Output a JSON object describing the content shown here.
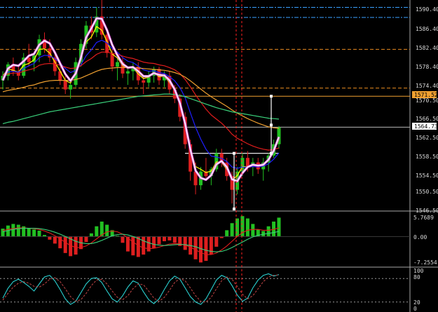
{
  "colors": {
    "background": "#000000",
    "axis_text": "#d8d8d8",
    "divider": "#a8a8a8",
    "candle_up": "#22c022",
    "candle_down": "#dd1f1f",
    "fast_ma": "#ffff00",
    "mid_ma": "#1e1eff",
    "slow_ma": "#e11c1c",
    "orange_ma": "#f0a030",
    "long_ma": "#3ad17b",
    "smooth_line": "#ffffff",
    "smooth_band": "#d850d8",
    "dash_blue": "#3aa0ff",
    "dash_orange": "#e98a1f",
    "level_orange": "#f0a030",
    "current_price_line": "#b8b8b8",
    "highlight_red": "#ff2020",
    "stoch_main": "#2ad0d0",
    "stoch_signal": "#b04040"
  },
  "price_axis": {
    "ticks": [
      "1590.40",
      "1586.40",
      "1582.40",
      "1578.40",
      "1574.40",
      "1570.50",
      "1566.50",
      "1562.50",
      "1558.50",
      "1554.50",
      "1550.50",
      "1546.50"
    ],
    "level_tag": "1571.52",
    "current_tag": "1564.73"
  },
  "macd_axis": {
    "ticks": [
      "5.7689",
      "0.00",
      "-7.2554"
    ]
  },
  "stoch_axis": {
    "ticks": [
      "100",
      "80",
      "20",
      "0"
    ]
  },
  "chart_data": [
    {
      "type": "line",
      "panel": "price",
      "title": "",
      "xlabel": "",
      "ylabel": "",
      "ylim": [
        1546.5,
        1592.0
      ],
      "ohlc": [
        [
          1575.0,
          1577.0,
          1573.0,
          1576.0
        ],
        [
          1576.0,
          1579.0,
          1575.0,
          1578.5
        ],
        [
          1578.5,
          1580.0,
          1576.0,
          1577.0
        ],
        [
          1577.0,
          1578.0,
          1575.0,
          1576.0
        ],
        [
          1576.0,
          1581.0,
          1575.5,
          1580.0
        ],
        [
          1580.0,
          1583.0,
          1578.0,
          1579.0
        ],
        [
          1579.0,
          1581.0,
          1577.0,
          1580.5
        ],
        [
          1580.5,
          1585.0,
          1579.0,
          1584.0
        ],
        [
          1584.0,
          1585.5,
          1581.0,
          1582.0
        ],
        [
          1582.0,
          1584.0,
          1579.0,
          1580.0
        ],
        [
          1580.0,
          1581.0,
          1576.0,
          1577.0
        ],
        [
          1577.0,
          1578.0,
          1574.0,
          1575.0
        ],
        [
          1575.0,
          1576.0,
          1572.0,
          1573.0
        ],
        [
          1573.0,
          1575.0,
          1571.0,
          1574.0
        ],
        [
          1574.0,
          1580.0,
          1573.5,
          1579.0
        ],
        [
          1579.0,
          1584.0,
          1578.0,
          1583.0
        ],
        [
          1583.0,
          1588.0,
          1582.0,
          1587.0
        ],
        [
          1587.0,
          1589.0,
          1584.0,
          1585.5
        ],
        [
          1585.5,
          1591.0,
          1584.5,
          1589.0
        ],
        [
          1589.0,
          1593.0,
          1584.0,
          1585.0
        ],
        [
          1585.0,
          1586.0,
          1580.0,
          1581.0
        ],
        [
          1581.0,
          1582.0,
          1577.0,
          1578.0
        ],
        [
          1578.0,
          1580.0,
          1575.0,
          1579.0
        ],
        [
          1579.0,
          1580.0,
          1575.5,
          1576.5
        ],
        [
          1576.5,
          1578.0,
          1574.0,
          1577.0
        ],
        [
          1577.0,
          1579.0,
          1575.0,
          1578.0
        ],
        [
          1578.0,
          1579.0,
          1574.0,
          1575.0
        ],
        [
          1575.0,
          1576.0,
          1572.0,
          1574.5
        ],
        [
          1574.5,
          1577.0,
          1573.5,
          1576.0
        ],
        [
          1576.0,
          1578.0,
          1574.5,
          1577.5
        ],
        [
          1577.5,
          1578.0,
          1574.0,
          1575.0
        ],
        [
          1575.0,
          1577.0,
          1573.5,
          1576.0
        ],
        [
          1576.0,
          1577.0,
          1572.0,
          1573.0
        ],
        [
          1573.0,
          1574.0,
          1570.0,
          1571.0
        ],
        [
          1571.0,
          1572.0,
          1566.0,
          1567.0
        ],
        [
          1567.0,
          1568.0,
          1560.0,
          1561.0
        ],
        [
          1561.0,
          1562.0,
          1553.0,
          1555.0
        ],
        [
          1555.0,
          1557.0,
          1550.0,
          1552.0
        ],
        [
          1552.0,
          1556.0,
          1551.0,
          1555.0
        ],
        [
          1555.0,
          1558.0,
          1553.0,
          1554.0
        ],
        [
          1554.0,
          1556.0,
          1552.0,
          1555.5
        ],
        [
          1555.5,
          1560.0,
          1555.0,
          1559.0
        ],
        [
          1559.0,
          1560.0,
          1556.0,
          1557.0
        ],
        [
          1557.0,
          1558.0,
          1553.0,
          1554.0
        ],
        [
          1554.0,
          1555.0,
          1548.0,
          1551.0
        ],
        [
          1551.0,
          1556.0,
          1550.0,
          1555.0
        ],
        [
          1555.0,
          1559.0,
          1554.0,
          1558.0
        ],
        [
          1558.0,
          1559.5,
          1555.0,
          1556.0
        ],
        [
          1556.0,
          1558.0,
          1554.0,
          1557.0
        ],
        [
          1557.0,
          1558.0,
          1554.5,
          1555.5
        ],
        [
          1555.5,
          1558.0,
          1553.0,
          1557.0
        ],
        [
          1557.0,
          1559.0,
          1555.0,
          1558.5
        ],
        [
          1558.5,
          1562.0,
          1558.0,
          1561.0
        ],
        [
          1561.0,
          1565.0,
          1560.0,
          1564.7
        ]
      ],
      "series": [
        {
          "values": [
            1576.0,
            1577.5,
            1577.2,
            1576.8,
            1578.3,
            1578.7,
            1579.5,
            1581.8,
            1581.9,
            1581.0,
            1579.0,
            1577.0,
            1575.0,
            1574.4,
            1576.7,
            1579.9,
            1583.4,
            1584.5,
            1586.8,
            1586.0,
            1583.5,
            1580.8,
            1579.9,
            1578.2,
            1577.6,
            1577.8,
            1576.4,
            1575.4,
            1575.7,
            1576.6,
            1575.8,
            1575.9,
            1574.5,
            1572.7,
            1569.8,
            1565.4,
            1560.2,
            1556.1,
            1555.5,
            1554.8,
            1555.1,
            1557.1,
            1557.0,
            1555.5,
            1553.2,
            1554.1,
            1556.1,
            1556.0,
            1556.5,
            1556.0,
            1556.5,
            1557.5,
            1559.3,
            1562.0
          ],
          "color_key": "fast_ma"
        },
        {
          "values": [
            1576.0,
            1576.8,
            1577.0,
            1576.8,
            1577.6,
            1578.2,
            1578.7,
            1580.0,
            1580.5,
            1580.4,
            1579.8,
            1578.8,
            1577.6,
            1576.7,
            1577.2,
            1578.4,
            1580.4,
            1581.7,
            1583.3,
            1583.8,
            1583.2,
            1582.0,
            1581.2,
            1580.0,
            1579.2,
            1578.9,
            1578.1,
            1577.3,
            1577.0,
            1577.1,
            1576.7,
            1576.5,
            1575.8,
            1574.9,
            1573.4,
            1571.2,
            1567.9,
            1564.7,
            1562.1,
            1559.9,
            1558.4,
            1558.2,
            1557.9,
            1557.2,
            1556.0,
            1555.7,
            1556.0,
            1555.9,
            1556.1,
            1556.0,
            1556.2,
            1556.7,
            1557.7,
            1559.1
          ],
          "color_key": "mid_ma"
        },
        {
          "values": [
            1576.0,
            1576.4,
            1576.6,
            1576.6,
            1577.0,
            1577.3,
            1577.6,
            1578.3,
            1578.6,
            1578.7,
            1578.6,
            1578.3,
            1577.9,
            1577.6,
            1577.7,
            1578.2,
            1579.1,
            1579.8,
            1580.7,
            1581.2,
            1581.2,
            1580.9,
            1580.7,
            1580.3,
            1580.0,
            1579.8,
            1579.4,
            1579.0,
            1578.8,
            1578.7,
            1578.4,
            1578.2,
            1577.8,
            1577.3,
            1576.5,
            1575.2,
            1573.6,
            1571.8,
            1570.2,
            1568.7,
            1567.4,
            1566.5,
            1565.6,
            1564.5,
            1563.2,
            1562.3,
            1561.7,
            1561.1,
            1560.6,
            1560.2,
            1559.9,
            1559.7,
            1559.8,
            1560.2
          ],
          "color_key": "slow_ma"
        },
        {
          "values": [
            1572.5,
            1572.8,
            1573.0,
            1573.2,
            1573.5,
            1573.8,
            1574.0,
            1574.4,
            1574.7,
            1574.9,
            1575.0,
            1575.0,
            1575.0,
            1575.0,
            1575.2,
            1575.5,
            1576.0,
            1576.5,
            1577.0,
            1577.4,
            1577.6,
            1577.7,
            1577.8,
            1577.8,
            1577.8,
            1577.8,
            1577.7,
            1577.6,
            1577.5,
            1577.4,
            1577.3,
            1577.2,
            1577.0,
            1576.7,
            1576.3,
            1575.7,
            1574.9,
            1574.0,
            1573.1,
            1572.2,
            1571.4,
            1570.7,
            1570.0,
            1569.3,
            1568.5,
            1567.8,
            1567.2,
            1566.6,
            1566.1,
            1565.6,
            1565.2,
            1564.8,
            1564.6,
            1564.5
          ],
          "color_key": "orange_ma"
        },
        {
          "values": [
            1565.5,
            1565.8,
            1566.0,
            1566.3,
            1566.6,
            1566.9,
            1567.2,
            1567.5,
            1567.8,
            1568.1,
            1568.3,
            1568.5,
            1568.7,
            1568.9,
            1569.1,
            1569.3,
            1569.5,
            1569.7,
            1569.9,
            1570.1,
            1570.3,
            1570.5,
            1570.7,
            1570.9,
            1571.1,
            1571.3,
            1571.5,
            1571.6,
            1571.7,
            1571.8,
            1571.9,
            1572.0,
            1572.0,
            1571.9,
            1571.7,
            1571.4,
            1571.0,
            1570.6,
            1570.2,
            1569.8,
            1569.4,
            1569.0,
            1568.7,
            1568.4,
            1568.1,
            1567.9,
            1567.7,
            1567.5,
            1567.3,
            1567.1,
            1566.9,
            1566.7,
            1566.6,
            1566.5
          ],
          "color_key": "long_ma"
        },
        {
          "values": [
            1575.0,
            1577.6,
            1578.4,
            1578.2,
            1579.2,
            1580.4,
            1580.8,
            1582.8,
            1583.7,
            1583.1,
            1581.1,
            1578.7,
            1576.4,
            1574.9,
            1576.5,
            1580.0,
            1584.4,
            1586.4,
            1588.6,
            1588.5,
            1586.0,
            1582.8,
            1580.5,
            1578.6,
            1577.8,
            1577.9,
            1577.0,
            1575.9,
            1575.9,
            1576.6,
            1576.2,
            1576.1,
            1575.0,
            1573.0,
            1570.0,
            1565.5,
            1559.9,
            1555.2,
            1553.6,
            1553.2,
            1554.2,
            1556.6,
            1557.3,
            1556.0,
            1553.3,
            1552.9,
            1554.7,
            1556.0,
            1556.5,
            1556.3,
            1556.5,
            1557.6,
            1559.6,
            1562.6
          ],
          "color_key": "smooth_line"
        }
      ],
      "levels": [
        {
          "value": 1591.0,
          "style": "dash-dot",
          "color_key": "dash_blue"
        },
        {
          "value": 1588.8,
          "style": "dash-dot",
          "color_key": "dash_blue"
        },
        {
          "value": 1581.8,
          "style": "dashed",
          "color_key": "dash_orange"
        },
        {
          "value": 1573.3,
          "style": "dashed",
          "color_key": "dash_orange"
        },
        {
          "value": 1571.52,
          "style": "solid",
          "color_key": "level_orange"
        },
        {
          "value": 1564.73,
          "style": "solid",
          "color_key": "current_price_line"
        },
        {
          "value": 1559.0,
          "style": "solid-segment",
          "color_key": "smooth_line"
        }
      ]
    },
    {
      "type": "bar",
      "panel": "macd",
      "title": "",
      "ylim": [
        -7.2554,
        5.7689
      ],
      "series": [
        {
          "values": [
            2.0,
            2.8,
            3.2,
            3.0,
            2.6,
            2.2,
            1.8,
            1.5,
            0.4,
            -0.8,
            -1.8,
            -3.0,
            -4.2,
            -5.0,
            -4.6,
            -3.2,
            -1.4,
            0.8,
            2.6,
            3.8,
            3.0,
            1.6,
            0.2,
            -1.6,
            -3.8,
            -4.8,
            -5.2,
            -4.6,
            -3.8,
            -3.0,
            -2.0,
            -1.2,
            -1.0,
            -1.6,
            -2.4,
            -3.4,
            -4.6,
            -5.8,
            -6.6,
            -6.2,
            -4.6,
            -2.6,
            -0.4,
            1.6,
            3.4,
            4.6,
            5.2,
            4.6,
            3.2,
            1.8,
            1.4,
            2.6,
            3.8,
            4.8
          ],
          "color_key": "candle_up"
        },
        {
          "values": [
            1.5,
            1.8,
            2.0,
            2.2,
            2.2,
            2.1,
            2.0,
            1.8,
            1.4,
            0.9,
            0.2,
            -0.6,
            -1.5,
            -2.3,
            -2.8,
            -2.8,
            -2.4,
            -1.6,
            -0.6,
            0.4,
            1.2,
            1.4,
            1.2,
            0.6,
            -0.4,
            -1.4,
            -2.3,
            -2.9,
            -3.1,
            -3.0,
            -2.7,
            -2.3,
            -1.9,
            -1.8,
            -1.9,
            -2.2,
            -2.7,
            -3.4,
            -4.1,
            -4.6,
            -4.6,
            -4.2,
            -3.4,
            -2.4,
            -1.2,
            0.0,
            1.0,
            1.6,
            1.8,
            1.8,
            1.6,
            1.6,
            1.8,
            2.2
          ],
          "color_key": "slow_ma"
        },
        {
          "values": [
            1.2,
            1.5,
            1.8,
            2.0,
            2.1,
            2.1,
            2.1,
            2.0,
            1.8,
            1.5,
            1.1,
            0.6,
            0.0,
            -0.6,
            -1.2,
            -1.6,
            -1.8,
            -1.8,
            -1.5,
            -1.0,
            -0.4,
            0.2,
            0.5,
            0.6,
            0.4,
            0.0,
            -0.5,
            -1.1,
            -1.6,
            -2.0,
            -2.2,
            -2.3,
            -2.2,
            -2.1,
            -2.0,
            -2.1,
            -2.3,
            -2.6,
            -3.1,
            -3.5,
            -3.8,
            -3.9,
            -3.8,
            -3.4,
            -2.8,
            -2.1,
            -1.4,
            -0.7,
            -0.1,
            0.3,
            0.6,
            0.8,
            1.0,
            1.3
          ],
          "color_key": "long_ma"
        }
      ]
    },
    {
      "type": "line",
      "panel": "stochastic",
      "title": "",
      "ylim": [
        0,
        100
      ],
      "series": [
        {
          "values": [
            30,
            55,
            72,
            78,
            70,
            60,
            48,
            66,
            84,
            88,
            74,
            52,
            28,
            14,
            22,
            44,
            66,
            80,
            82,
            70,
            48,
            28,
            20,
            36,
            58,
            74,
            68,
            46,
            26,
            16,
            28,
            52,
            74,
            86,
            78,
            56,
            34,
            20,
            14,
            28,
            52,
            76,
            88,
            82,
            62,
            38,
            22,
            30,
            56,
            76,
            88,
            92,
            86,
            90
          ],
          "color_key": "stoch_main"
        },
        {
          "values": [
            25,
            42,
            58,
            68,
            72,
            68,
            60,
            58,
            66,
            78,
            82,
            72,
            54,
            34,
            22,
            26,
            42,
            62,
            76,
            78,
            66,
            48,
            32,
            26,
            36,
            54,
            66,
            64,
            48,
            30,
            22,
            32,
            50,
            70,
            80,
            74,
            56,
            36,
            22,
            20,
            32,
            54,
            74,
            84,
            78,
            60,
            40,
            28,
            36,
            54,
            72,
            84,
            88,
            89
          ],
          "color_key": "stoch_signal"
        }
      ]
    }
  ]
}
